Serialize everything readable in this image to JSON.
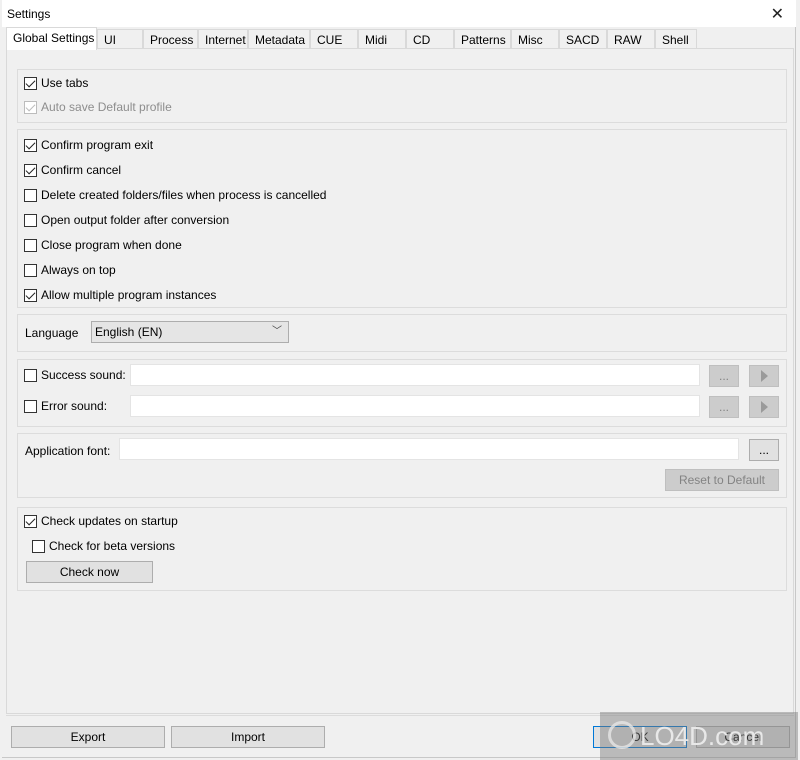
{
  "window": {
    "title": "Settings",
    "close_icon": "close-icon"
  },
  "tabs": [
    {
      "label": "Global Settings",
      "active": true
    },
    {
      "label": "UI"
    },
    {
      "label": "Process"
    },
    {
      "label": "Internet"
    },
    {
      "label": "Metadata"
    },
    {
      "label": "CUE"
    },
    {
      "label": "Midi"
    },
    {
      "label": "CD"
    },
    {
      "label": "Patterns"
    },
    {
      "label": "Misc"
    },
    {
      "label": "SACD"
    },
    {
      "label": "RAW"
    },
    {
      "label": "Shell"
    }
  ],
  "group1": {
    "use_tabs": {
      "label": "Use tabs",
      "checked": true
    },
    "auto_save": {
      "label": "Auto save Default profile",
      "checked": true,
      "disabled": true
    }
  },
  "group2": {
    "items": [
      {
        "label": "Confirm program exit",
        "checked": true
      },
      {
        "label": "Confirm cancel",
        "checked": true
      },
      {
        "label": "Delete created folders/files when process is cancelled",
        "checked": false
      },
      {
        "label": "Open output folder after conversion",
        "checked": false
      },
      {
        "label": "Close program when done",
        "checked": false
      },
      {
        "label": "Always on top",
        "checked": false
      },
      {
        "label": "Allow multiple program instances",
        "checked": true
      }
    ]
  },
  "language": {
    "label": "Language",
    "selected": "English (EN)"
  },
  "sounds": {
    "success": {
      "label": "Success sound:",
      "checked": false,
      "value": "",
      "browse": "...",
      "play_icon": "play-icon"
    },
    "error": {
      "label": "Error sound:",
      "checked": false,
      "value": "",
      "browse": "...",
      "play_icon": "play-icon"
    }
  },
  "font": {
    "label": "Application font:",
    "value": "",
    "browse": "...",
    "reset": "Reset to Default"
  },
  "updates": {
    "check_startup": {
      "label": "Check updates on startup",
      "checked": true
    },
    "check_beta": {
      "label": "Check for beta versions",
      "checked": false
    },
    "check_now": "Check now"
  },
  "footer": {
    "export": "Export",
    "import": "Import",
    "ok": "OK",
    "cancel": "Cancel"
  },
  "watermark": "LO4D.com"
}
